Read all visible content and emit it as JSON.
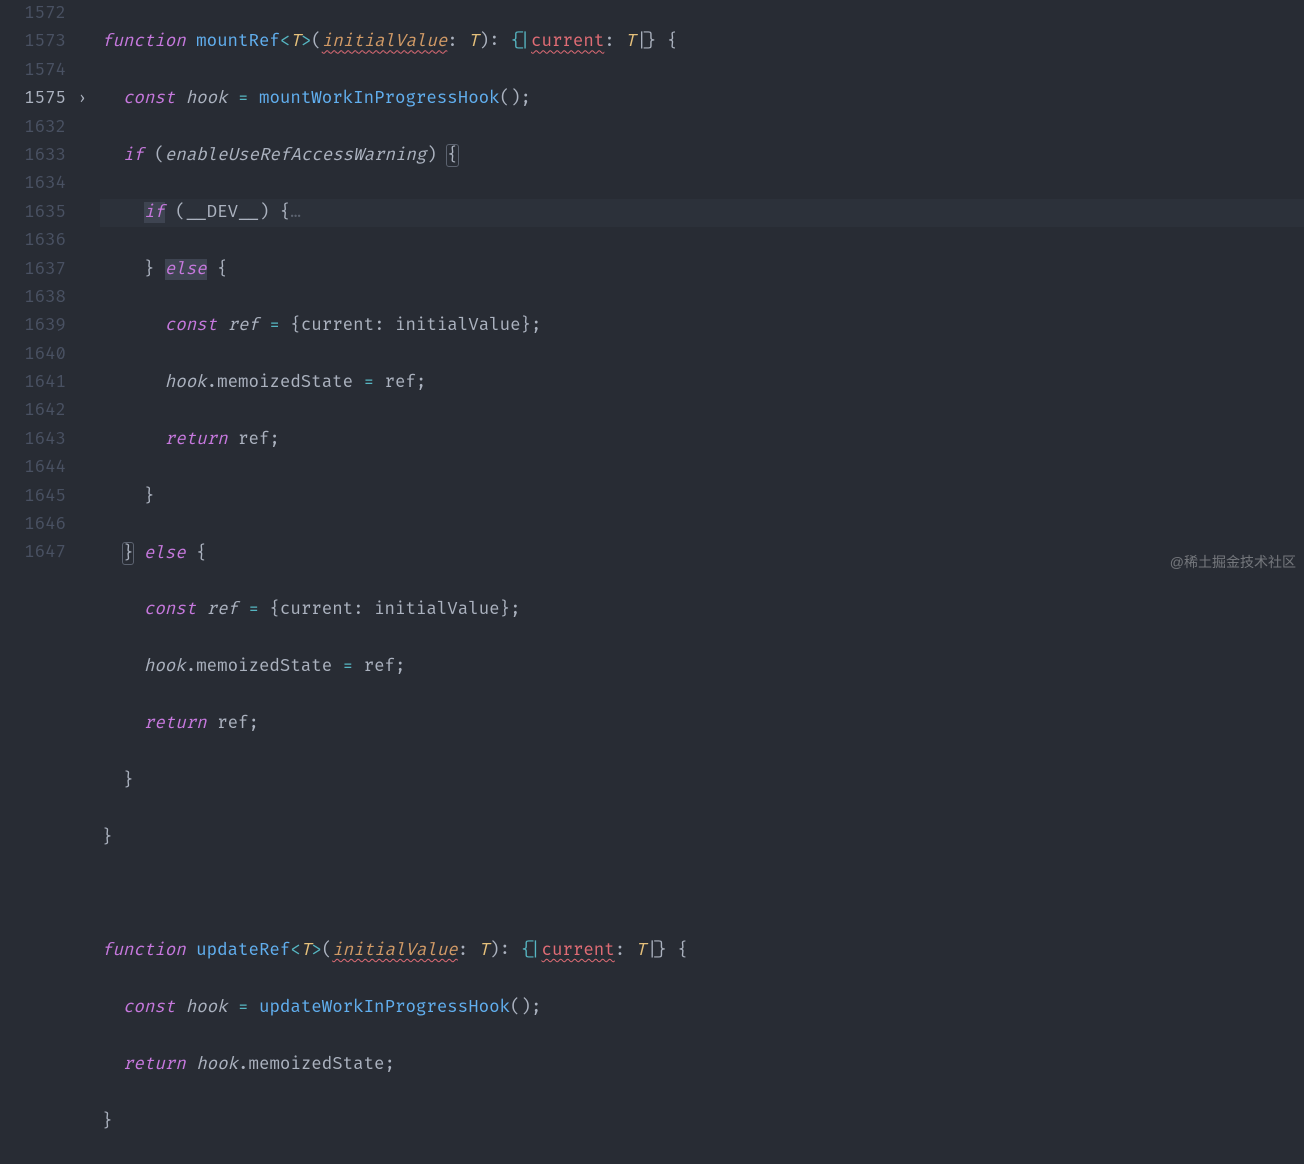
{
  "gutter": {
    "lines": [
      "1572",
      "1573",
      "1574",
      "1575",
      "1632",
      "1633",
      "1634",
      "1635",
      "1636",
      "1637",
      "1638",
      "1639",
      "1640",
      "1641",
      "1642",
      "1643",
      "1644",
      "1645",
      "1646",
      "1647"
    ],
    "activeIndex": 3,
    "foldIndex": 3,
    "foldGlyph": "›"
  },
  "tok": {
    "function": "function",
    "const": "const",
    "if": "if",
    "else": "else",
    "return": "return",
    "mountRef": "mountRef",
    "updateRef": "updateRef",
    "mountWorkInProgressHook": "mountWorkInProgressHook",
    "updateWorkInProgressHook": "updateWorkInProgressHook",
    "T": "T",
    "initialValue": "initialValue",
    "current": "current",
    "hook": "hook",
    "ref": "ref",
    "memoizedState": "memoizedState",
    "enableUseRefAccessWarning": "enableUseRefAccessWarning",
    "__DEV__": "__DEV__",
    "ellipsis": "…",
    "pipe": "|",
    "colon": ":",
    "lbrace": "{",
    "rbrace": "}",
    "lparen": "(",
    "rparen": ")",
    "lt": "<",
    "gt": ">",
    "eq": "=",
    "semi": ";",
    "dot": ".",
    "comma": ","
  },
  "watermark": "@稀土掘金技术社区"
}
